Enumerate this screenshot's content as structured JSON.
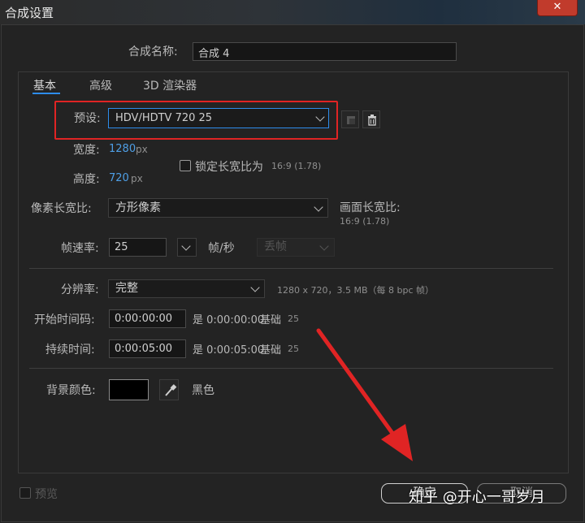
{
  "window": {
    "title": "合成设置",
    "close_glyph": "✕"
  },
  "composition": {
    "name_label": "合成名称:",
    "name_value": "合成 4"
  },
  "tabs": [
    {
      "label": "基本",
      "active": true
    },
    {
      "label": "高级",
      "active": false
    },
    {
      "label": "3D 渲染器",
      "active": false
    }
  ],
  "preset": {
    "label": "预设:",
    "value": "HDV/HDTV 720 25"
  },
  "width": {
    "label": "宽度:",
    "value": "1280",
    "unit": "px"
  },
  "height": {
    "label": "高度:",
    "value": "720",
    "unit": "px"
  },
  "lock_aspect": {
    "label": "锁定长宽比为",
    "ratio": "16:9 (1.78)",
    "checked": false
  },
  "pixel_aspect": {
    "label": "像素长宽比:",
    "value": "方形像素"
  },
  "frame_aspect": {
    "label": "画面长宽比:",
    "value": "16:9 (1.78)"
  },
  "frame_rate": {
    "label": "帧速率:",
    "value": "25",
    "unit": "帧/秒",
    "drop_frame": "丢帧"
  },
  "resolution": {
    "label": "分辨率:",
    "value": "完整",
    "info": "1280 x 720，3.5 MB（每 8 bpc 帧）"
  },
  "start_timecode": {
    "label": "开始时间码:",
    "value": "0:00:00:00",
    "is_text": "是 0:00:00:00",
    "base_label": "基础",
    "base_value": "25"
  },
  "duration": {
    "label": "持续时间:",
    "value": "0:00:05:00",
    "is_text": "是 0:00:05:00",
    "base_label": "基础",
    "base_value": "25"
  },
  "background": {
    "label": "背景颜色:",
    "color": "#000000",
    "color_name": "黑色"
  },
  "footer": {
    "preview_label": "预览",
    "ok_label": "确定",
    "cancel_label": "取消"
  },
  "watermark": "知乎 @开心一哥岁月",
  "colors": {
    "accent": "#2d8ceb",
    "annotation": "#e02424",
    "value_blue": "#4e9fe6"
  }
}
